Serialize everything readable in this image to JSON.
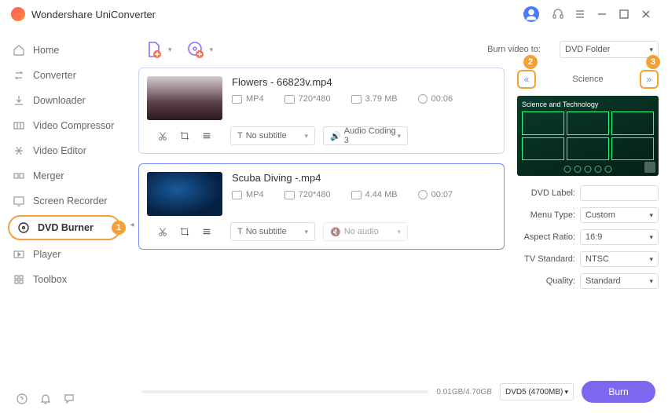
{
  "app": {
    "brand": "Wondershare UniConverter"
  },
  "sidebar": {
    "items": [
      {
        "label": "Home"
      },
      {
        "label": "Converter"
      },
      {
        "label": "Downloader"
      },
      {
        "label": "Video Compressor"
      },
      {
        "label": "Video Editor"
      },
      {
        "label": "Merger"
      },
      {
        "label": "Screen Recorder"
      },
      {
        "label": "DVD Burner",
        "badge": "1"
      },
      {
        "label": "Player"
      },
      {
        "label": "Toolbox"
      }
    ]
  },
  "toolbar": {
    "burn_to_label": "Burn video to:",
    "burn_to_value": "DVD Folder"
  },
  "files": [
    {
      "name": "Flowers - 66823v.mp4",
      "format": "MP4",
      "res": "720*480",
      "size": "3.79 MB",
      "dur": "00:06",
      "subtitle": "No subtitle",
      "audio": "Audio Coding 3"
    },
    {
      "name": "Scuba Diving -.mp4",
      "format": "MP4",
      "res": "720*480",
      "size": "4.44 MB",
      "dur": "00:07",
      "subtitle": "No subtitle",
      "audio": "No audio"
    }
  ],
  "theme": {
    "nav_left_badge": "2",
    "nav_right_badge": "3",
    "name": "Science",
    "preview_title": "Science and Technology"
  },
  "settings": {
    "dvd_label_lbl": "DVD Label:",
    "dvd_label_val": "",
    "menu_type_lbl": "Menu Type:",
    "menu_type_val": "Custom",
    "aspect_lbl": "Aspect Ratio:",
    "aspect_val": "16:9",
    "tv_lbl": "TV Standard:",
    "tv_val": "NTSC",
    "quality_lbl": "Quality:",
    "quality_val": "Standard"
  },
  "bottom": {
    "size_text": "0.01GB/4.70GB",
    "disc": "DVD5 (4700MB)",
    "burn_label": "Burn"
  }
}
